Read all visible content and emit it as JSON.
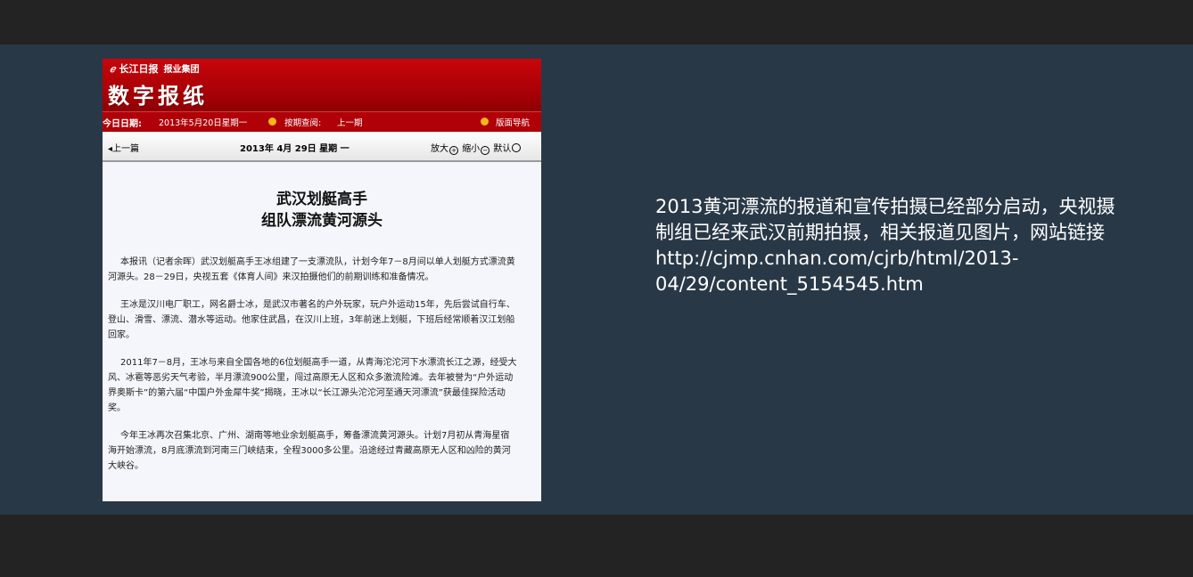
{
  "newspaper": {
    "brand_logo_text": "长江日报",
    "brand_group": "报业集团",
    "title": "数字报纸",
    "nav": {
      "today_label": "今日日期:",
      "today_value": "2013年5月20日星期一",
      "prev_query_label": "按期查阅:",
      "prev_query_value": "上一期",
      "guide": "版面导航"
    },
    "datebar": {
      "prev_link": "上一篇",
      "date": "2013年  4月  29日    星期  一",
      "zoom_in": "放大",
      "zoom_out": "缩小",
      "default": "默认"
    },
    "headline_line1": "武汉划艇高手",
    "headline_line2": "组队漂流黄河源头",
    "paragraphs": [
      "本报讯（记者余晖）武汉划艇高手王冰组建了一支漂流队，计划今年7－8月间以单人划艇方式漂流黄河源头。28－29日，央视五套《体育人间》来汉拍摄他们的前期训练和准备情况。",
      "王冰是汉川电厂职工，网名爵士冰，是武汉市著名的户外玩家，玩户外运动15年，先后尝试自行车、登山、滑雪、漂流、潜水等运动。他家住武昌，在汉川上班，3年前迷上划艇，下班后经常顺着汉江划船回家。",
      "2011年7－8月，王冰与来自全国各地的6位划艇高手一道，从青海沱沱河下水漂流长江之源，经受大风、冰雹等恶劣天气考验，半月漂流900公里，闯过高原无人区和众多激流险滩。去年被誉为“户外运动界奥斯卡”的第六届“中国户外金犀牛奖”揭晓，王冰以“长江源头沱沱河至通天河漂流”获最佳探险活动奖。",
      "今年王冰再次召集北京、广州、湖南等地业余划艇高手，筹备漂流黄河源头。计划7月初从青海星宿海开始漂流，8月底漂流到河南三门峡结束，全程3000多公里。沿途经过青藏高原无人区和凶险的黄河大峡谷。"
    ]
  },
  "caption": {
    "line1": "2013黄河漂流的报道和宣传拍摄已经部分启动，央视摄",
    "line2": "制组已经来武汉前期拍摄，相关报道见图片，网站链接",
    "line3": "http://cjmp.cnhan.com/cjrb/html/2013-",
    "line4": "04/29/content_5154545.htm"
  }
}
